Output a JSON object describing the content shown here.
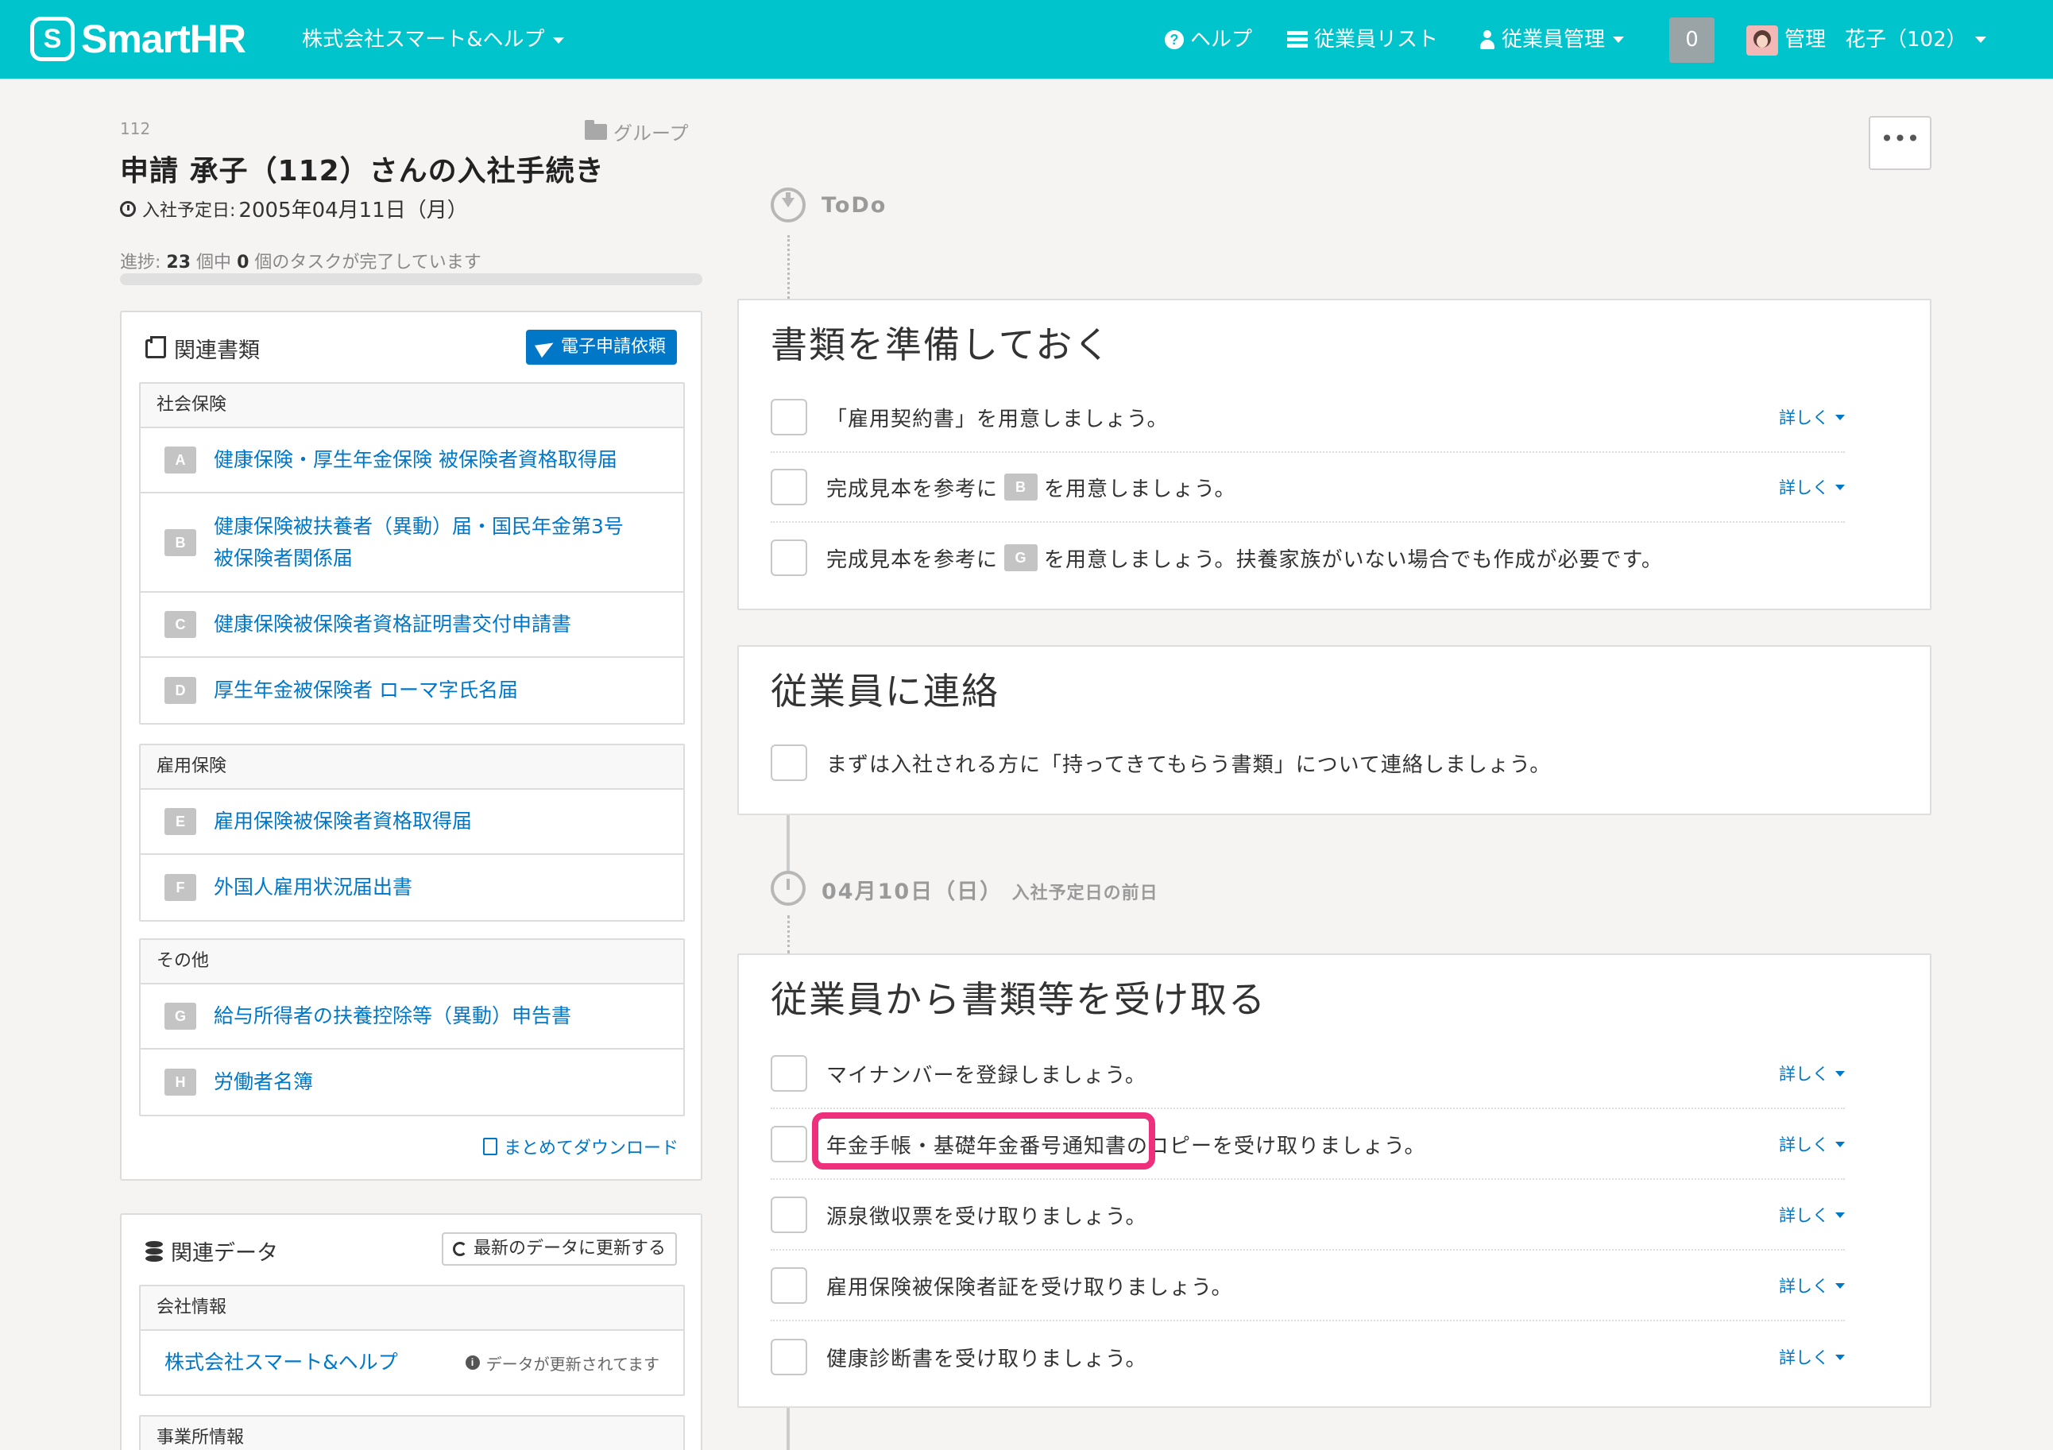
{
  "header": {
    "logo_text": "SmartHR",
    "company": "株式会社スマート&ヘルプ",
    "help": "ヘルプ",
    "employee_list": "従業員リスト",
    "employee_mgmt": "従業員管理",
    "badge": "0",
    "user_role": "管理",
    "user_name": "花子（102）"
  },
  "page": {
    "employee_number": "112",
    "group_label": "グループ",
    "title": "申請 承子（112）さんの入社手続き",
    "join_date_label": "入社予定日:",
    "join_date": "2005年04月11日（月）",
    "progress_prefix": "進捗:",
    "progress_total": "23",
    "progress_mid": "個中",
    "progress_done": "0",
    "progress_suffix": "個のタスクが完了しています",
    "progress_fraction": 0,
    "more_label": "•••"
  },
  "docs_panel": {
    "title": "関連書類",
    "request_button": "電子申請依頼",
    "groups": [
      {
        "label": "社会保険",
        "items": [
          {
            "letter": "A",
            "name": "健康保険・厚生年金保険 被保険者資格取得届"
          },
          {
            "letter": "B",
            "name": "健康保険被扶養者（異動）届・国民年金第3号",
            "name2": "被保険者関係届"
          },
          {
            "letter": "C",
            "name": "健康保険被保険者資格証明書交付申請書"
          },
          {
            "letter": "D",
            "name": "厚生年金被保険者 ローマ字氏名届"
          }
        ]
      },
      {
        "label": "雇用保険",
        "items": [
          {
            "letter": "E",
            "name": "雇用保険被保険者資格取得届"
          },
          {
            "letter": "F",
            "name": "外国人雇用状況届出書"
          }
        ]
      },
      {
        "label": "その他",
        "items": [
          {
            "letter": "G",
            "name": "給与所得者の扶養控除等（異動）申告書"
          },
          {
            "letter": "H",
            "name": "労働者名簿"
          }
        ]
      }
    ],
    "download": "まとめてダウンロード"
  },
  "data_panel": {
    "title": "関連データ",
    "refresh_button": "最新のデータに更新する",
    "company_label": "会社情報",
    "company_link": "株式会社スマート&ヘルプ",
    "company_note": "データが更新されてます",
    "office_label": "事業所情報"
  },
  "timeline": {
    "todo_label": "ToDo",
    "date_label": "04月10日（日）",
    "date_sub": "入社予定日の前日"
  },
  "cards": [
    {
      "title": "書類を準備しておく",
      "tasks": [
        {
          "text": "「雇用契約書」を用意しましょう。",
          "detail": "詳しく"
        },
        {
          "pre": "完成見本を参考に",
          "letter": "B",
          "post": "を用意しましょう。",
          "detail": "詳しく"
        },
        {
          "pre": "完成見本を参考に",
          "letter": "G",
          "post": "を用意しましょう。扶養家族がいない場合でも作成が必要です。"
        }
      ]
    },
    {
      "title": "従業員に連絡",
      "tasks": [
        {
          "text": "まずは入社される方に「持ってきてもらう書類」について連絡しましょう。"
        }
      ]
    },
    {
      "title": "従業員から書類等を受け取る",
      "tasks": [
        {
          "text": "マイナンバーを登録しましょう。",
          "detail": "詳しく"
        },
        {
          "text": "年金手帳・基礎年金番号通知書のコピーを受け取りましょう。",
          "detail": "詳しく"
        },
        {
          "text": "源泉徴収票を受け取りましょう。",
          "detail": "詳しく"
        },
        {
          "text": "雇用保険被保険者証を受け取りましょう。",
          "detail": "詳しく"
        },
        {
          "text": "健康診断書を受け取りましょう。",
          "detail": "詳しく"
        }
      ]
    }
  ],
  "colors": {
    "header": "#00c4cc",
    "link": "#0077c7",
    "highlight": "#ee2f7c"
  }
}
